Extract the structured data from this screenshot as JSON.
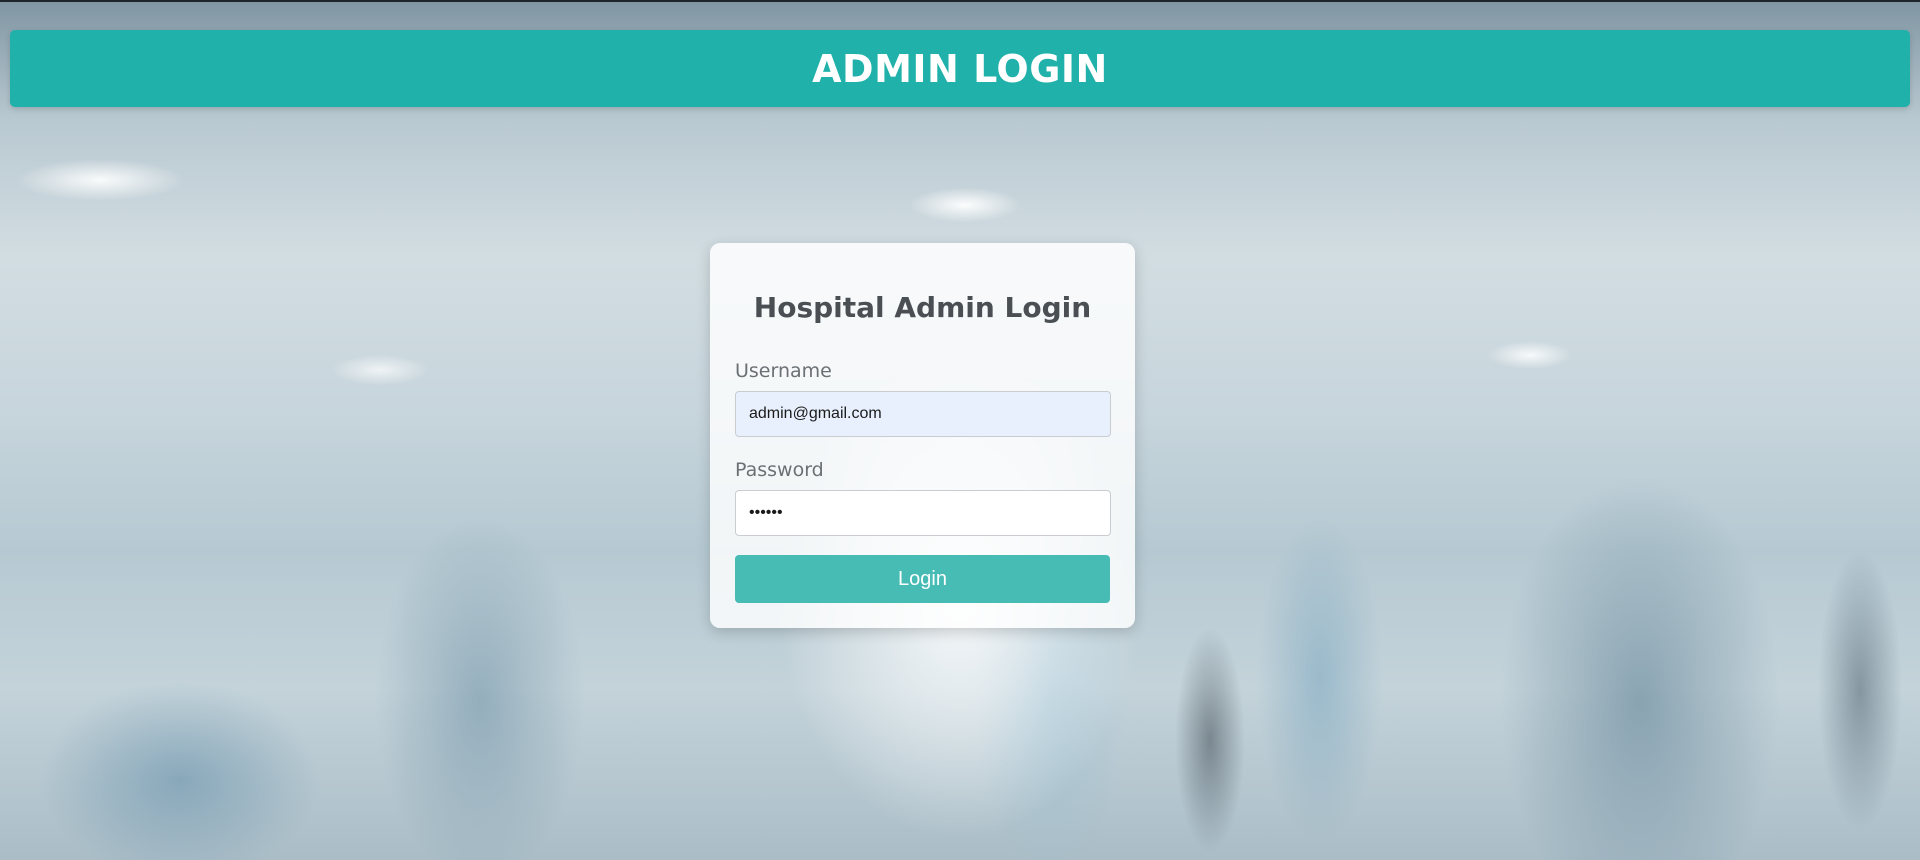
{
  "header": {
    "title": "ADMIN LOGIN"
  },
  "login_form": {
    "title": "Hospital Admin Login",
    "username_label": "Username",
    "username_value": "admin@gmail.com",
    "password_label": "Password",
    "password_value": "••••••",
    "login_button_label": "Login"
  },
  "colors": {
    "header_background": "#20b2aa",
    "button_background": "#46bcb5",
    "autofill_input_background": "#e8f0fd"
  }
}
